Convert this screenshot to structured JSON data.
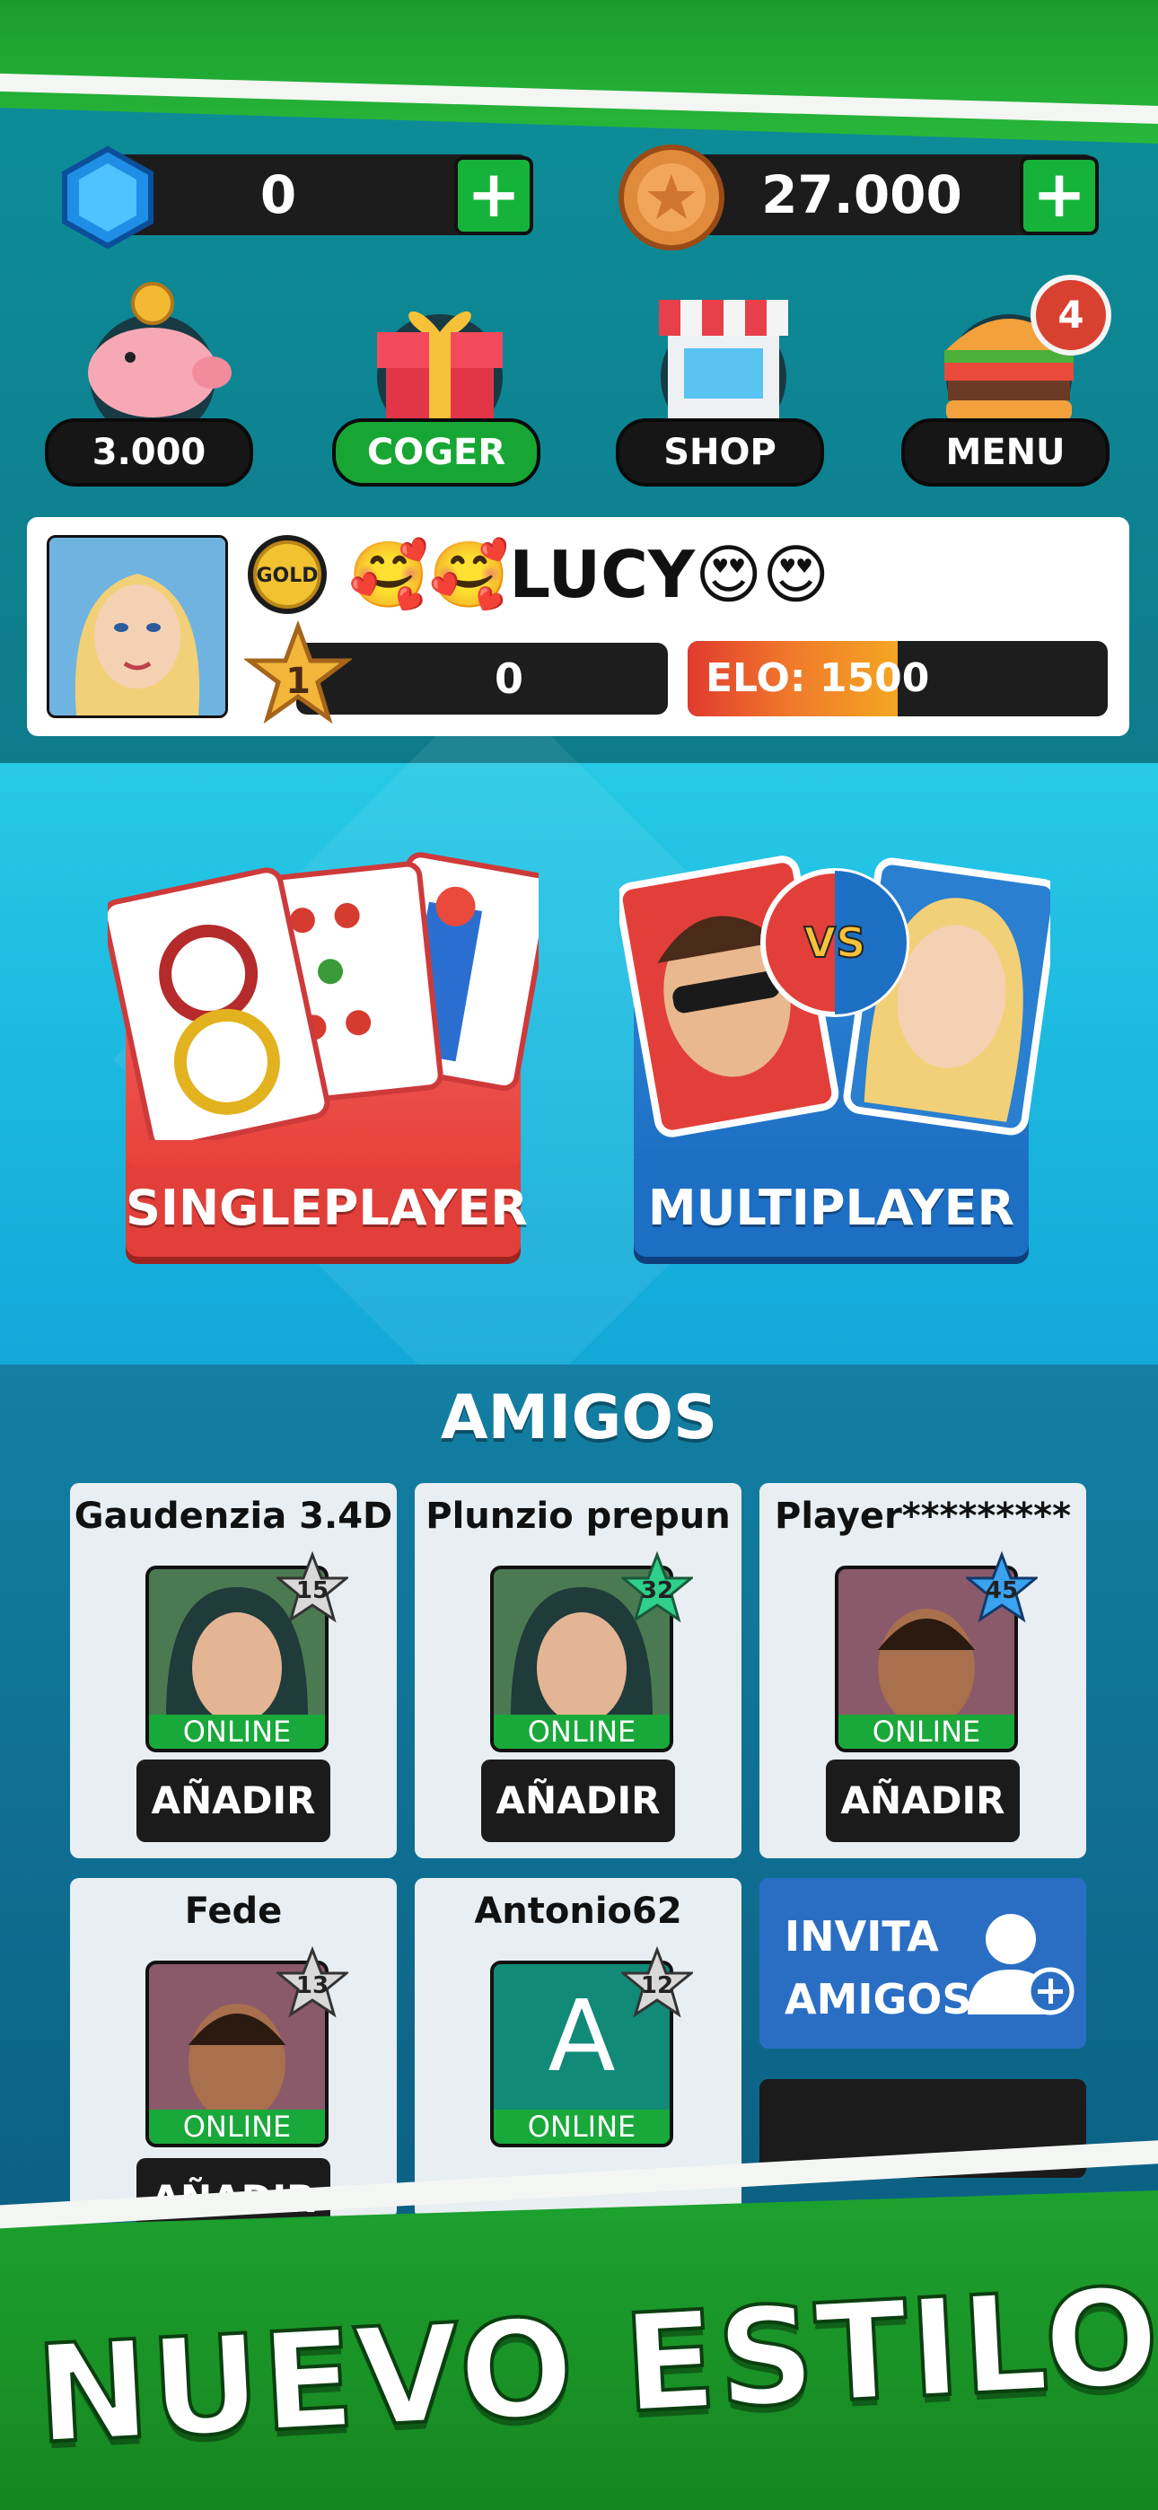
{
  "currencies": {
    "gems": {
      "value": "0",
      "icon": "gem-icon",
      "add_icon": "plus-icon"
    },
    "coins": {
      "value": "27.000",
      "icon": "coin-icon",
      "add_icon": "plus-icon"
    }
  },
  "quick_actions": [
    {
      "icon": "piggy-bank-icon",
      "label": "3.000"
    },
    {
      "icon": "gift-icon",
      "label": "COGER"
    },
    {
      "icon": "shop-icon",
      "label": "SHOP"
    },
    {
      "icon": "burger-menu-icon",
      "label": "MENU",
      "badge": "4"
    }
  ],
  "profile": {
    "gold_badge": "GOLD",
    "name_prefix_emoji": "🥰🥰",
    "name": "LUCY",
    "name_suffix_emoji": "😍😍",
    "level": "1",
    "xp": "0",
    "elo": "ELO: 1500",
    "elo_progress": 0.5
  },
  "modes": {
    "single": {
      "label": "SINGLEPLAYER"
    },
    "multi": {
      "label": "MULTIPLAYER",
      "vs": "VS"
    }
  },
  "friends": {
    "title": "AMIGOS",
    "status": "ONLINE",
    "add_label": "AÑADIR",
    "list": [
      {
        "name": "Gaudenzia 3.4D",
        "level": "15"
      },
      {
        "name": "Plunzio prepun",
        "level": "32"
      },
      {
        "name": "Player*********",
        "level": "45"
      },
      {
        "name": "Fede",
        "level": "13"
      },
      {
        "name": "Antonio62",
        "level": "12",
        "initial": "A"
      }
    ],
    "invite_label": "INVITA AMIGOS",
    "invite_icon": "add-user-icon"
  },
  "footer": {
    "text": "NUEVO ESTILO",
    "emoji": "🥰"
  },
  "colors": {
    "green": "#16b33a",
    "red": "#e4473c",
    "blue": "#1d6fc4",
    "teal": "#0e7b8b"
  }
}
